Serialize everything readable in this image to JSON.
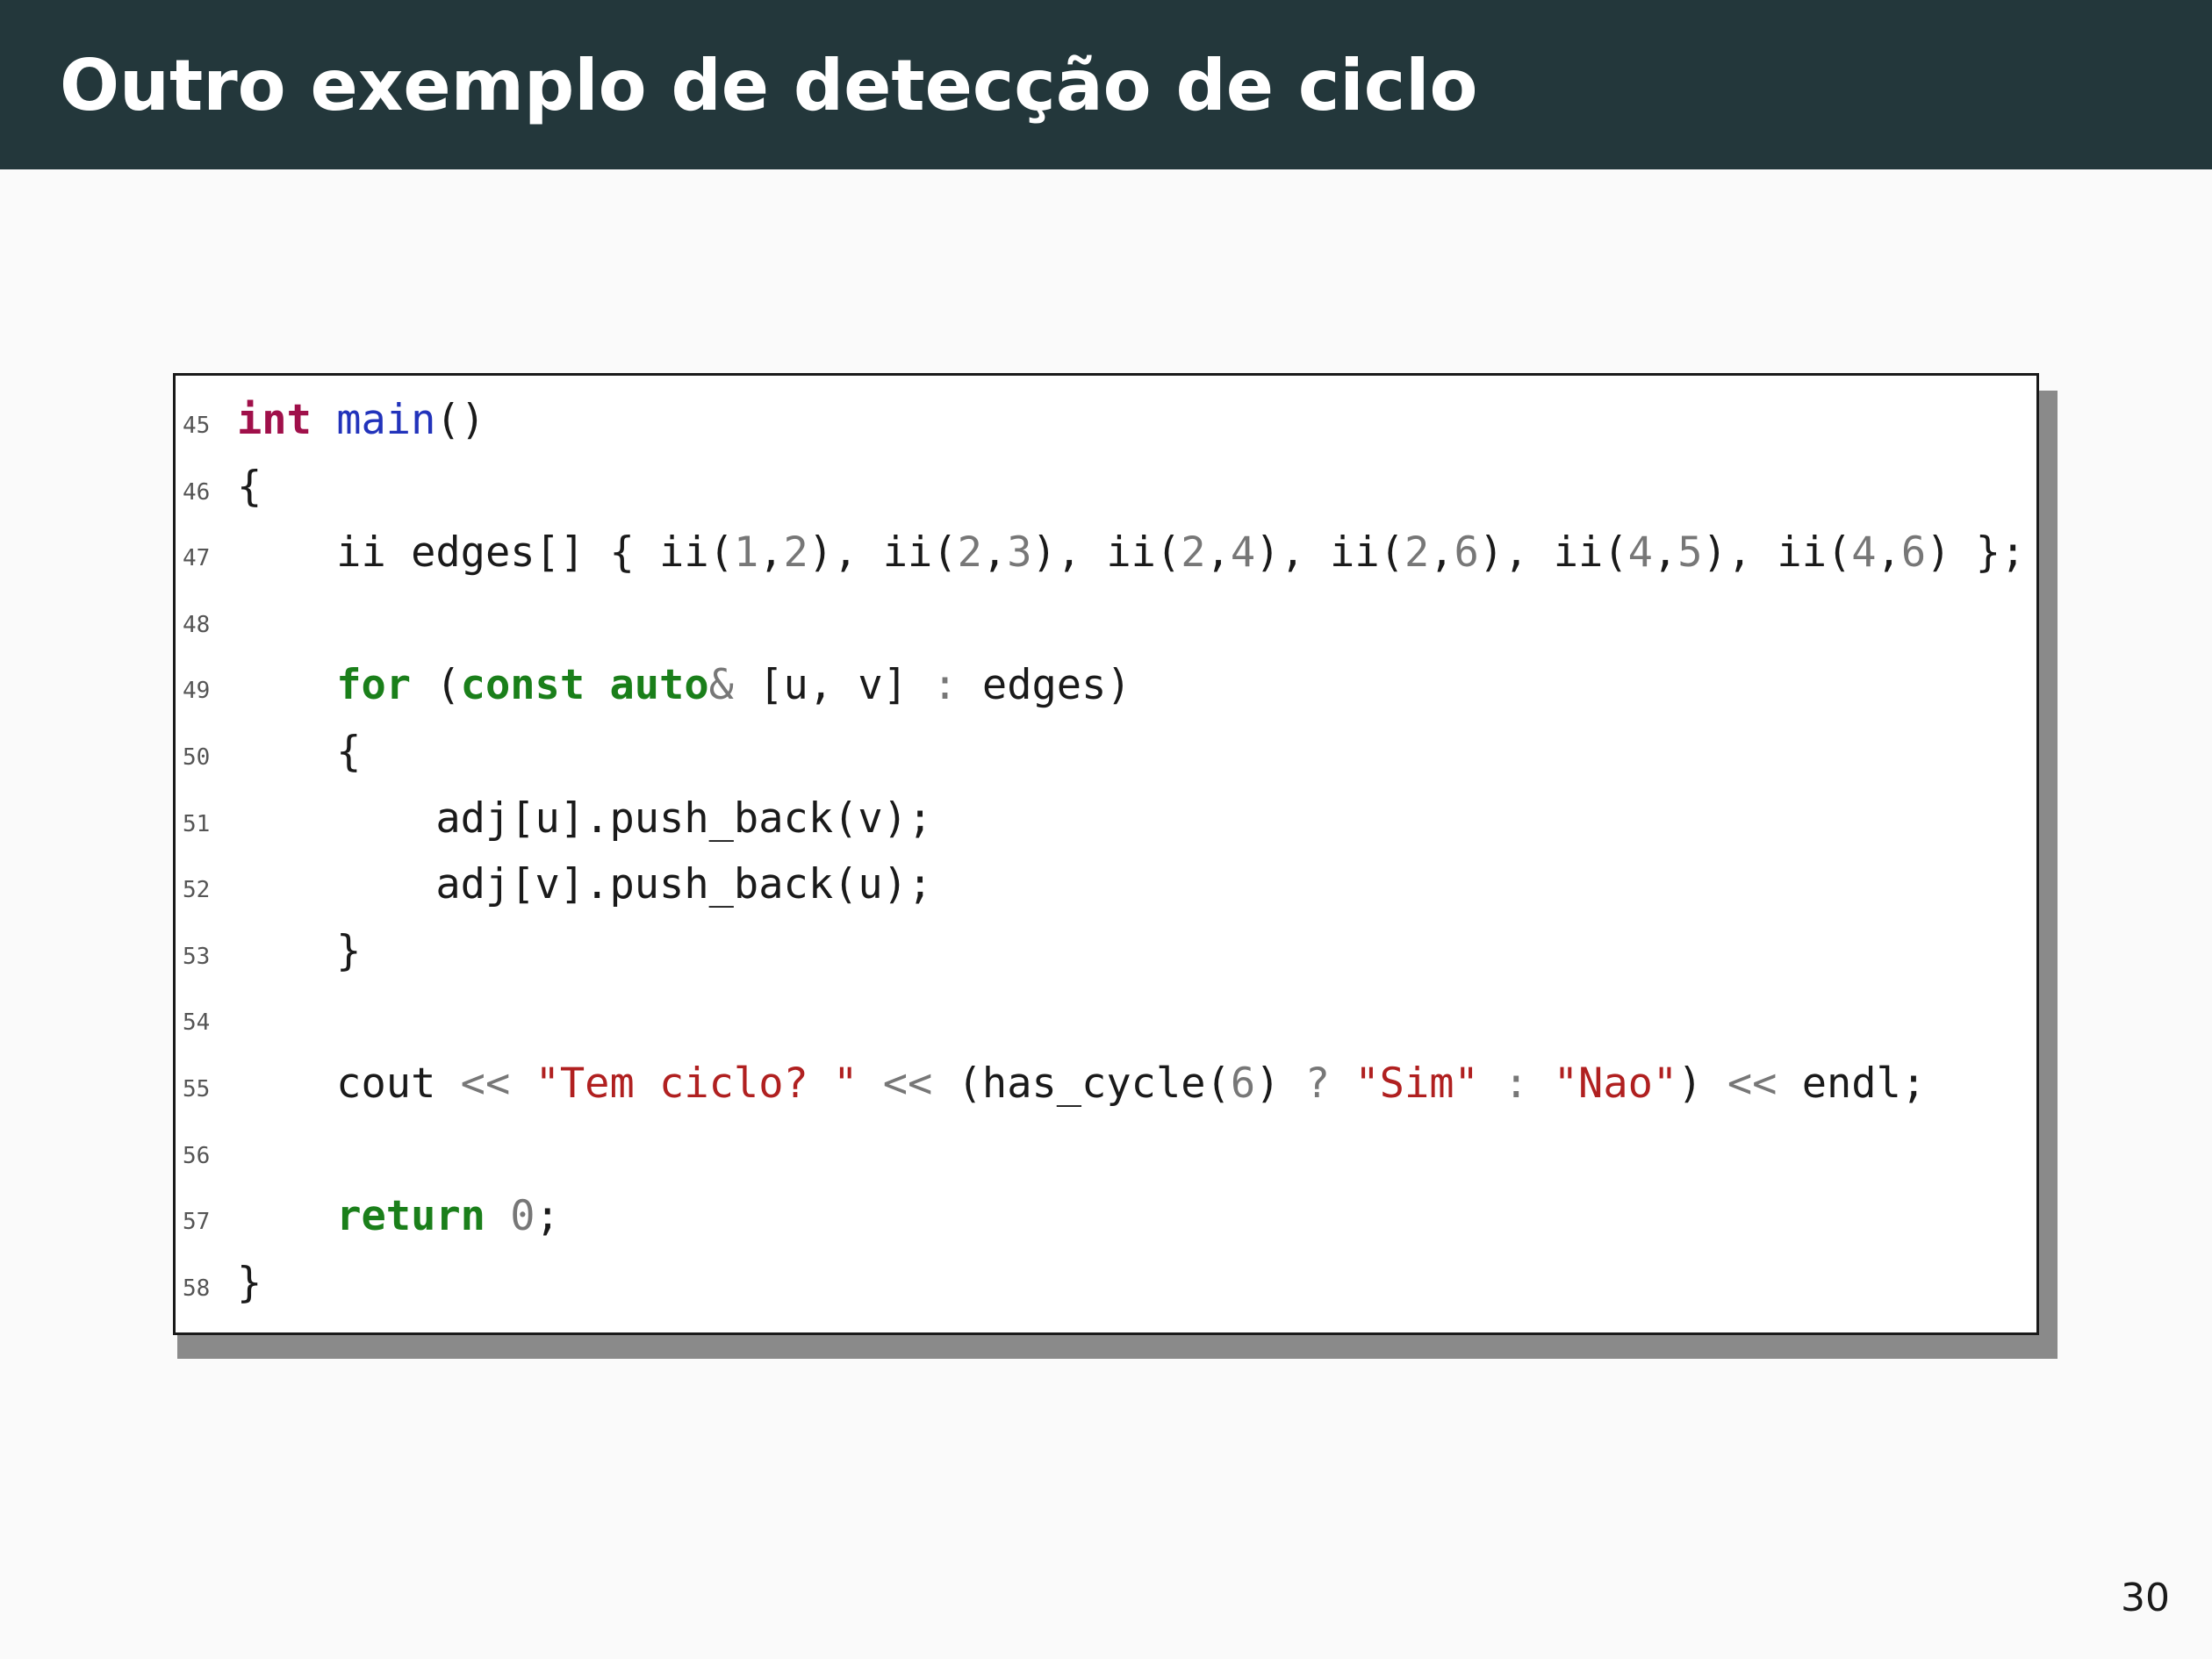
{
  "slide": {
    "title": "Outro exemplo de detecção de ciclo",
    "page_number": "30"
  },
  "code_block": {
    "language": "cpp",
    "lines": [
      {
        "number": "45",
        "tokens": [
          {
            "text": "int",
            "kind": "type"
          },
          {
            "text": " ",
            "kind": "plain"
          },
          {
            "text": "main",
            "kind": "function"
          },
          {
            "text": "()",
            "kind": "plain"
          }
        ]
      },
      {
        "number": "46",
        "tokens": [
          {
            "text": "{",
            "kind": "plain"
          }
        ]
      },
      {
        "number": "47",
        "tokens": [
          {
            "text": "    ii edges[] { ii(",
            "kind": "plain"
          },
          {
            "text": "1",
            "kind": "number"
          },
          {
            "text": ",",
            "kind": "plain"
          },
          {
            "text": "2",
            "kind": "number"
          },
          {
            "text": "), ii(",
            "kind": "plain"
          },
          {
            "text": "2",
            "kind": "number"
          },
          {
            "text": ",",
            "kind": "plain"
          },
          {
            "text": "3",
            "kind": "number"
          },
          {
            "text": "), ii(",
            "kind": "plain"
          },
          {
            "text": "2",
            "kind": "number"
          },
          {
            "text": ",",
            "kind": "plain"
          },
          {
            "text": "4",
            "kind": "number"
          },
          {
            "text": "), ii(",
            "kind": "plain"
          },
          {
            "text": "2",
            "kind": "number"
          },
          {
            "text": ",",
            "kind": "plain"
          },
          {
            "text": "6",
            "kind": "number"
          },
          {
            "text": "), ii(",
            "kind": "plain"
          },
          {
            "text": "4",
            "kind": "number"
          },
          {
            "text": ",",
            "kind": "plain"
          },
          {
            "text": "5",
            "kind": "number"
          },
          {
            "text": "), ii(",
            "kind": "plain"
          },
          {
            "text": "4",
            "kind": "number"
          },
          {
            "text": ",",
            "kind": "plain"
          },
          {
            "text": "6",
            "kind": "number"
          },
          {
            "text": ") };",
            "kind": "plain"
          }
        ]
      },
      {
        "number": "48",
        "tokens": []
      },
      {
        "number": "49",
        "tokens": [
          {
            "text": "    ",
            "kind": "plain"
          },
          {
            "text": "for",
            "kind": "keyword"
          },
          {
            "text": " (",
            "kind": "plain"
          },
          {
            "text": "const",
            "kind": "keyword"
          },
          {
            "text": " ",
            "kind": "plain"
          },
          {
            "text": "auto",
            "kind": "keyword"
          },
          {
            "text": "&",
            "kind": "operator"
          },
          {
            "text": " [u, v] ",
            "kind": "plain"
          },
          {
            "text": ":",
            "kind": "operator"
          },
          {
            "text": " edges)",
            "kind": "plain"
          }
        ]
      },
      {
        "number": "50",
        "tokens": [
          {
            "text": "    {",
            "kind": "plain"
          }
        ]
      },
      {
        "number": "51",
        "tokens": [
          {
            "text": "        adj[u].push_back(v);",
            "kind": "plain"
          }
        ]
      },
      {
        "number": "52",
        "tokens": [
          {
            "text": "        adj[v].push_back(u);",
            "kind": "plain"
          }
        ]
      },
      {
        "number": "53",
        "tokens": [
          {
            "text": "    }",
            "kind": "plain"
          }
        ]
      },
      {
        "number": "54",
        "tokens": []
      },
      {
        "number": "55",
        "tokens": [
          {
            "text": "    cout ",
            "kind": "plain"
          },
          {
            "text": "<<",
            "kind": "operator"
          },
          {
            "text": " ",
            "kind": "plain"
          },
          {
            "text": "\"Tem ciclo? \"",
            "kind": "string"
          },
          {
            "text": " ",
            "kind": "plain"
          },
          {
            "text": "<<",
            "kind": "operator"
          },
          {
            "text": " (has_cycle(",
            "kind": "plain"
          },
          {
            "text": "6",
            "kind": "number"
          },
          {
            "text": ") ",
            "kind": "plain"
          },
          {
            "text": "?",
            "kind": "operator"
          },
          {
            "text": " ",
            "kind": "plain"
          },
          {
            "text": "\"Sim\"",
            "kind": "string"
          },
          {
            "text": " ",
            "kind": "plain"
          },
          {
            "text": ":",
            "kind": "operator"
          },
          {
            "text": " ",
            "kind": "plain"
          },
          {
            "text": "\"Nao\"",
            "kind": "string"
          },
          {
            "text": ") ",
            "kind": "plain"
          },
          {
            "text": "<<",
            "kind": "operator"
          },
          {
            "text": " endl;",
            "kind": "plain"
          }
        ]
      },
      {
        "number": "56",
        "tokens": []
      },
      {
        "number": "57",
        "tokens": [
          {
            "text": "    ",
            "kind": "plain"
          },
          {
            "text": "return",
            "kind": "keyword"
          },
          {
            "text": " ",
            "kind": "plain"
          },
          {
            "text": "0",
            "kind": "number"
          },
          {
            "text": ";",
            "kind": "plain"
          }
        ]
      },
      {
        "number": "58",
        "tokens": [
          {
            "text": "}",
            "kind": "plain"
          }
        ]
      }
    ]
  },
  "colors": {
    "title_bar": "#23373b",
    "keyword": "#1a7f1a",
    "type_keyword": "#a0104a",
    "function": "#2233bb",
    "string": "#b02020",
    "number": "#777777"
  }
}
